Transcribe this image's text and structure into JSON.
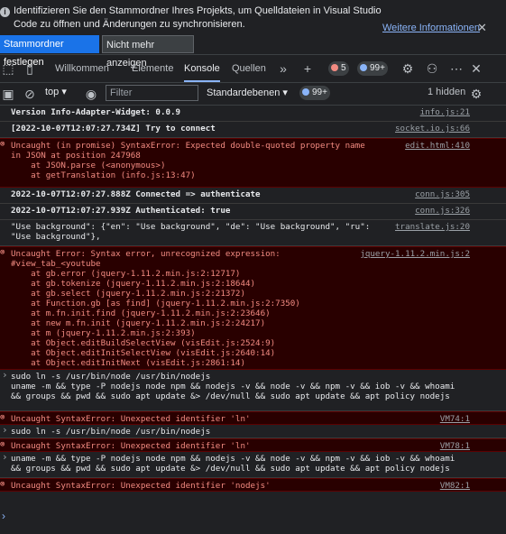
{
  "infobar": {
    "text": "Identifizieren Sie den Stammordner Ihres Projekts, um Quelldateien in Visual Studio Code zu öffnen und Änderungen zu synchronisieren.",
    "more_link": "Weitere Informationen",
    "set_button": "Stammordner festlegen",
    "dismiss_button": "Nicht mehr anzeigen"
  },
  "tabs": [
    "Willkommen",
    "Elemente",
    "Konsole",
    "Quellen"
  ],
  "badges": {
    "errors": "5",
    "issues": "99+"
  },
  "toolbar": {
    "context": "top",
    "filter_placeholder": "Filter",
    "levels": "Standardebenen",
    "issues": "99+",
    "hidden": "1 hidden"
  },
  "console": [
    {
      "type": "log",
      "lines": [
        "Version Info-Adapter-Widget: 0.0.9"
      ],
      "source": "info.js:21"
    },
    {
      "type": "log",
      "lines": [
        "[2022-10-07T12:07:27.734Z] Try to connect"
      ],
      "source": "socket.io.js:66"
    },
    {
      "type": "error",
      "lines": [
        "Uncaught (in promise) SyntaxError: Expected double-quoted property name",
        "in JSON at position 247968",
        "    at JSON.parse (<anonymous>)",
        "    at getTranslation (info.js:13:47)"
      ],
      "source": "edit.html:410"
    },
    {
      "type": "log",
      "lines": [
        "2022-10-07T12:07:27.888Z Connected => authenticate"
      ],
      "source": "conn.js:305"
    },
    {
      "type": "log",
      "lines": [
        "2022-10-07T12:07:27.939Z Authenticated: true"
      ],
      "source": "conn.js:326"
    },
    {
      "type": "log",
      "lines": [
        "\"Use background\": {\"en\": \"Use background\", \"de\": \"Use background\", \"ru\":",
        "\"Use background\"},"
      ],
      "source": "translate.js:20"
    },
    {
      "type": "error",
      "lines": [
        "Uncaught Error: Syntax error, unrecognized expression:",
        "#view_tab_<youtube",
        "    at gb.error (jquery-1.11.2.min.js:2:12717)",
        "    at gb.tokenize (jquery-1.11.2.min.js:2:18644)",
        "    at gb.select (jquery-1.11.2.min.js:2:21372)",
        "    at Function.gb [as find] (jquery-1.11.2.min.js:2:7350)",
        "    at m.fn.init.find (jquery-1.11.2.min.js:2:23646)",
        "    at new m.fn.init (jquery-1.11.2.min.js:2:24217)",
        "    at m (jquery-1.11.2.min.js:2:393)",
        "    at Object.editBuildSelectView (visEdit.js:2524:9)",
        "    at Object.editInitSelectView (visEdit.js:2640:14)",
        "    at Object.editInitNext (visEdit.js:2861:14)"
      ],
      "source": "jquery-1.11.2.min.js:2"
    },
    {
      "type": "input",
      "lines": [
        "sudo ln -s /usr/bin/node /usr/bin/nodejs",
        "uname -m && type -P nodejs node npm && nodejs -v && node -v && npm -v && iob -v && whoami",
        "&& groups && pwd && sudo apt update &> /dev/null && sudo apt update && apt policy nodejs"
      ],
      "source": ""
    },
    {
      "type": "error",
      "lines": [
        "Uncaught SyntaxError: Unexpected identifier 'ln'"
      ],
      "source": "VM74:1"
    },
    {
      "type": "input",
      "lines": [
        "sudo ln -s /usr/bin/node /usr/bin/nodejs"
      ],
      "source": ""
    },
    {
      "type": "error",
      "lines": [
        "Uncaught SyntaxError: Unexpected identifier 'ln'"
      ],
      "source": "VM78:1"
    },
    {
      "type": "input",
      "lines": [
        "uname -m && type -P nodejs node npm && nodejs -v && node -v && npm -v && iob -v && whoami",
        "&& groups && pwd && sudo apt update &> /dev/null && sudo apt update && apt policy nodejs"
      ],
      "source": ""
    },
    {
      "type": "error",
      "lines": [
        "Uncaught SyntaxError: Unexpected identifier 'nodejs'"
      ],
      "source": "VM82:1"
    }
  ],
  "colors": {
    "accent": "#8ab4f8",
    "error": "#f28b82",
    "error_bg": "#290000",
    "panel_bg": "#202124",
    "button_blue": "#1a73e8"
  }
}
